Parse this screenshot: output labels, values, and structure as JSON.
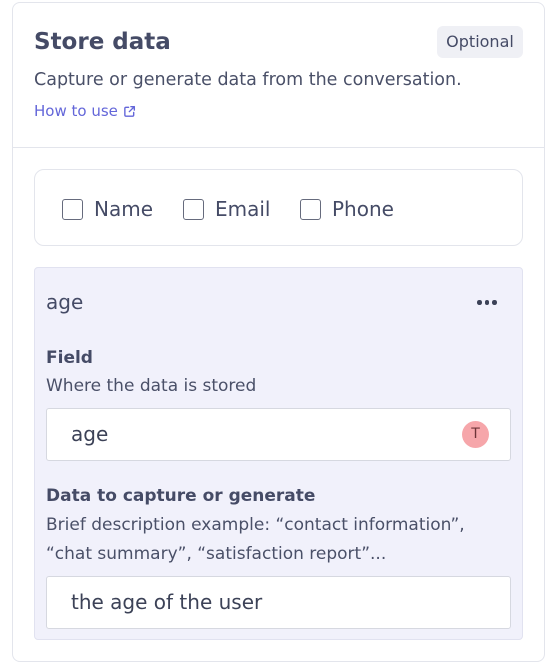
{
  "header": {
    "title": "Store data",
    "badge": "Optional",
    "subtitle": "Capture or generate data from the conversation.",
    "howto_label": "How to use"
  },
  "checkboxes": [
    {
      "label": "Name",
      "checked": false
    },
    {
      "label": "Email",
      "checked": false
    },
    {
      "label": "Phone",
      "checked": false
    }
  ],
  "card": {
    "title": "age",
    "field_label": "Field",
    "field_help": "Where the data is stored",
    "field_value": "age",
    "avatar_initial": "T",
    "capture_label": "Data to capture or generate",
    "capture_help_1": "Brief description example: “contact information”,",
    "capture_help_2": "“chat summary”, “satisfaction report”...",
    "capture_value": "the age of the user"
  },
  "colors": {
    "accent_link": "#6366d9",
    "card_bg": "#f1f1fb",
    "avatar_bg": "#f6a6aa"
  },
  "icons": [
    "external-link-icon",
    "more-horizontal-icon"
  ]
}
